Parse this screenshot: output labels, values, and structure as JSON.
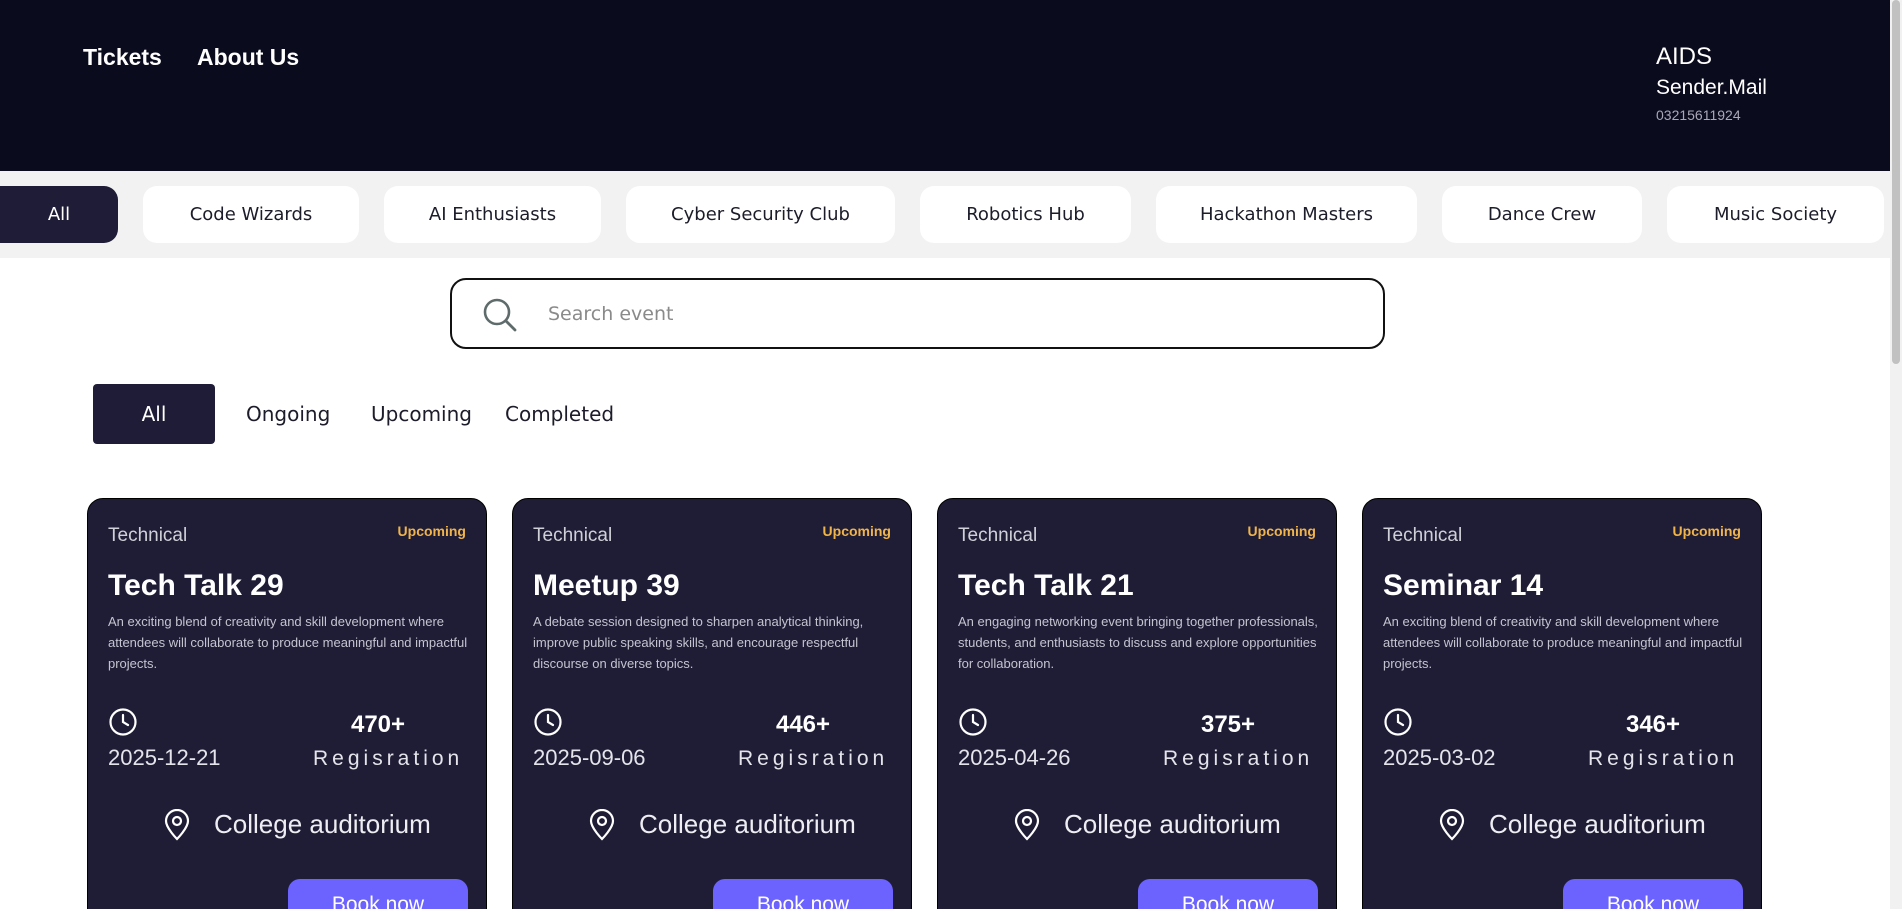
{
  "header": {
    "nav": [
      "Tickets",
      "About Us"
    ],
    "brand": {
      "name": "AIDS",
      "mail": "Sender.Mail",
      "phone": "03215611924"
    }
  },
  "clubs": [
    "All",
    "Code Wizards",
    "AI Enthusiasts",
    "Cyber Security Club",
    "Robotics Hub",
    "Hackathon Masters",
    "Dance Crew",
    "Music Society"
  ],
  "active_club": "All",
  "search": {
    "placeholder": "Search event",
    "value": ""
  },
  "tabs": [
    "All",
    "Ongoing",
    "Upcoming",
    "Completed"
  ],
  "active_tab": "All",
  "events": [
    {
      "category": "Technical",
      "status": "Upcoming",
      "title": "Tech Talk 29",
      "description": "An exciting blend of creativity and skill development where attendees will collaborate to produce meaningful and impactful projects.",
      "date": "2025-12-21",
      "registrations": "470+",
      "registration_label": "Regisration",
      "venue": "College auditorium",
      "button": "Book now"
    },
    {
      "category": "Technical",
      "status": "Upcoming",
      "title": "Meetup 39",
      "description": "A debate session designed to sharpen analytical thinking, improve public speaking skills, and encourage respectful discourse on diverse topics.",
      "date": "2025-09-06",
      "registrations": "446+",
      "registration_label": "Regisration",
      "venue": "College auditorium",
      "button": "Book now"
    },
    {
      "category": "Technical",
      "status": "Upcoming",
      "title": "Tech Talk 21",
      "description": "An engaging networking event bringing together professionals, students, and enthusiasts to discuss and explore opportunities for collaboration.",
      "date": "2025-04-26",
      "registrations": "375+",
      "registration_label": "Regisration",
      "venue": "College auditorium",
      "button": "Book now"
    },
    {
      "category": "Technical",
      "status": "Upcoming",
      "title": "Seminar 14",
      "description": "An exciting blend of creativity and skill development where attendees will collaborate to produce meaningful and impactful projects.",
      "date": "2025-03-02",
      "registrations": "346+",
      "registration_label": "Regisration",
      "venue": "College auditorium",
      "button": "Book now"
    }
  ],
  "colors": {
    "header_bg": "#0b0b1e",
    "card_bg": "#1f1d36",
    "accent": "#6c63ff",
    "status": "#f0b44a",
    "active_chip": "#1e1c36"
  },
  "icons": {
    "search": "search-icon",
    "clock": "clock-icon",
    "location": "location-pin-icon"
  }
}
